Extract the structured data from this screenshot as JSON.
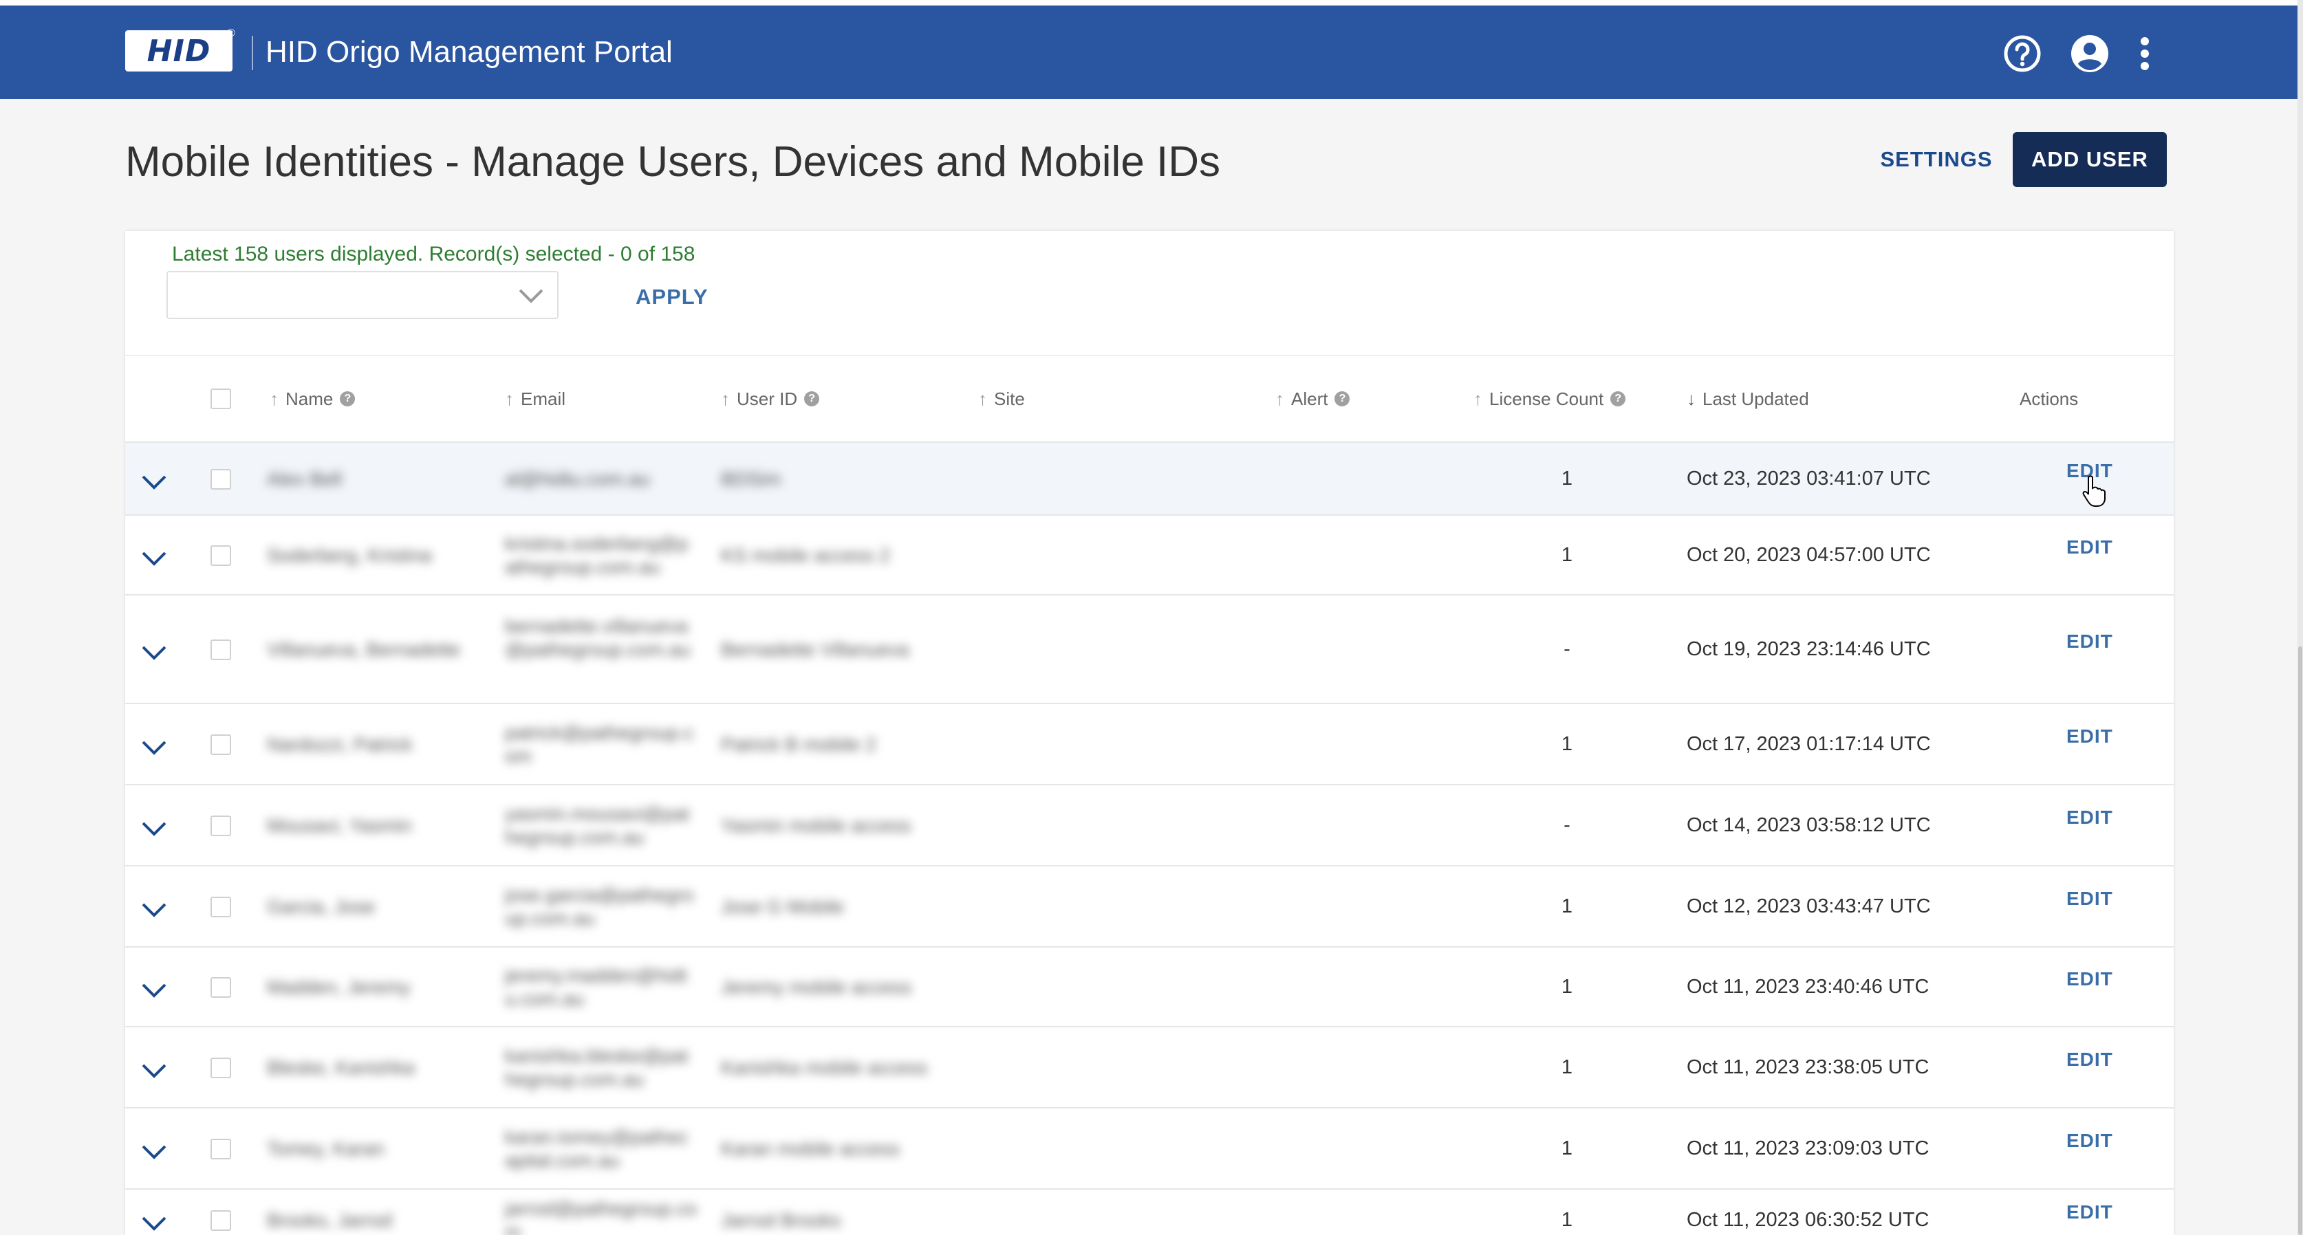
{
  "header": {
    "logo_text": "HID",
    "logo_reg": "®",
    "app_title": "HID Origo Management Portal",
    "icons": [
      "help-icon",
      "account-icon",
      "more-vert-icon"
    ]
  },
  "page": {
    "title": "Mobile Identities - Manage Users, Devices and Mobile IDs",
    "settings_label": "SETTINGS",
    "add_user_label": "ADD USER"
  },
  "filter": {
    "status_text": "Latest 158 users displayed. Record(s) selected - 0 of  158",
    "select_value": "",
    "apply_label": "APPLY"
  },
  "table": {
    "columns": {
      "name": "Name",
      "email": "Email",
      "user_id": "User ID",
      "site": "Site",
      "alert": "Alert",
      "license_count": "License Count",
      "last_updated": "Last Updated",
      "actions": "Actions"
    },
    "edit_label": "EDIT",
    "rows": [
      {
        "name": "Alex Bell",
        "email": "al@hidtu.com.au",
        "user_id": "BDSim",
        "license": "1",
        "updated": "Oct 23, 2023 03:41:07 UTC"
      },
      {
        "name": "Soderberg, Kristina",
        "email": "kristina.soderberg@pathegroup.com.au",
        "user_id": "KS mobile access 2",
        "license": "1",
        "updated": "Oct 20, 2023 04:57:00 UTC"
      },
      {
        "name": "Villanueva, Bernadette",
        "email": "bernadette.villanueva@pathegroup.com.au",
        "user_id": "Bernadette Villanueva",
        "license": "-",
        "updated": "Oct 19, 2023 23:14:46 UTC"
      },
      {
        "name": "Nardozzi, Patrick",
        "email": "patrick@pathegroup.com",
        "user_id": "Patrick B mobile 2",
        "license": "1",
        "updated": "Oct 17, 2023 01:17:14 UTC"
      },
      {
        "name": "Mousavi, Yasmin",
        "email": "yasmin.mousavi@pathegroup.com.au",
        "user_id": "Yasmin mobile access",
        "license": "-",
        "updated": "Oct 14, 2023 03:58:12 UTC"
      },
      {
        "name": "Garcia, Jose",
        "email": "jose.garcia@pathegroup.com.au",
        "user_id": "Jose G Mobile",
        "license": "1",
        "updated": "Oct 12, 2023 03:43:47 UTC"
      },
      {
        "name": "Madden, Jeremy",
        "email": "jeremy.madden@hidtu.com.au",
        "user_id": "Jeremy mobile access",
        "license": "1",
        "updated": "Oct 11, 2023 23:40:46 UTC"
      },
      {
        "name": "Bleske, Kanishka",
        "email": "kanishka.bleske@pathegroup.com.au",
        "user_id": "Kanishka mobile access",
        "license": "1",
        "updated": "Oct 11, 2023 23:38:05 UTC"
      },
      {
        "name": "Tomey, Karan",
        "email": "karan.tomey@pathecapital.com.au",
        "user_id": "Karan mobile access",
        "license": "1",
        "updated": "Oct 11, 2023 23:09:03 UTC"
      },
      {
        "name": "Brooks, Jarrod",
        "email": "jarrod@pathegroup.com",
        "user_id": "Jarrod Brooks",
        "license": "1",
        "updated": "Oct 11, 2023 06:30:52 UTC"
      }
    ]
  },
  "colors": {
    "appbar": "#2a55a0",
    "primary_button": "#152c57",
    "link": "#3a6ea8",
    "status_green": "#2e7d32"
  }
}
